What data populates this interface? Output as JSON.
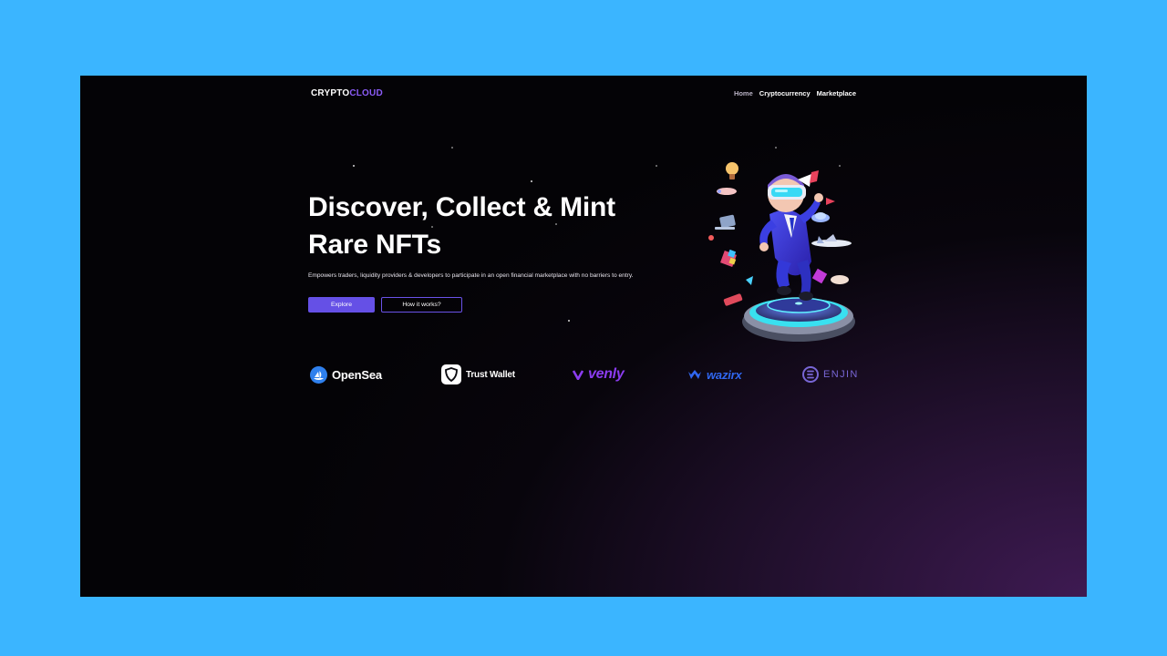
{
  "brand": {
    "logo_part1": "CRYPTO",
    "logo_part2": "CLOUD",
    "accent_color": "#8b5cf6"
  },
  "nav": {
    "items": [
      {
        "label": "Home",
        "active": false
      },
      {
        "label": "Cryptocurrency",
        "active": true
      },
      {
        "label": "Marketplace",
        "active": true
      }
    ]
  },
  "hero": {
    "title_line1": "Discover, Collect & Mint",
    "title_line2": "Rare NFTs",
    "subtitle": "Empowers traders, liquidity providers & developers to participate in an open financial marketplace with no barriers to entry.",
    "primary_button": "Explore",
    "secondary_button": "How it works?",
    "illustration_icon": "vr-astronaut-illustration"
  },
  "partners": [
    {
      "name": "OpenSea",
      "icon": "opensea-icon",
      "color": "#ffffff"
    },
    {
      "name": "Trust Wallet",
      "icon": "trust-wallet-icon",
      "color": "#ffffff"
    },
    {
      "name": "venly",
      "icon": "venly-icon",
      "color": "#8b3cf0"
    },
    {
      "name": "wazirx",
      "icon": "wazirx-icon",
      "color": "#3067f0"
    },
    {
      "name": "ENJIN",
      "icon": "enjin-icon",
      "color": "#7866d5"
    }
  ],
  "colors": {
    "page_bg": "#3bb5ff",
    "button_primary": "#6550e6",
    "button_outline": "#6a52e8"
  }
}
